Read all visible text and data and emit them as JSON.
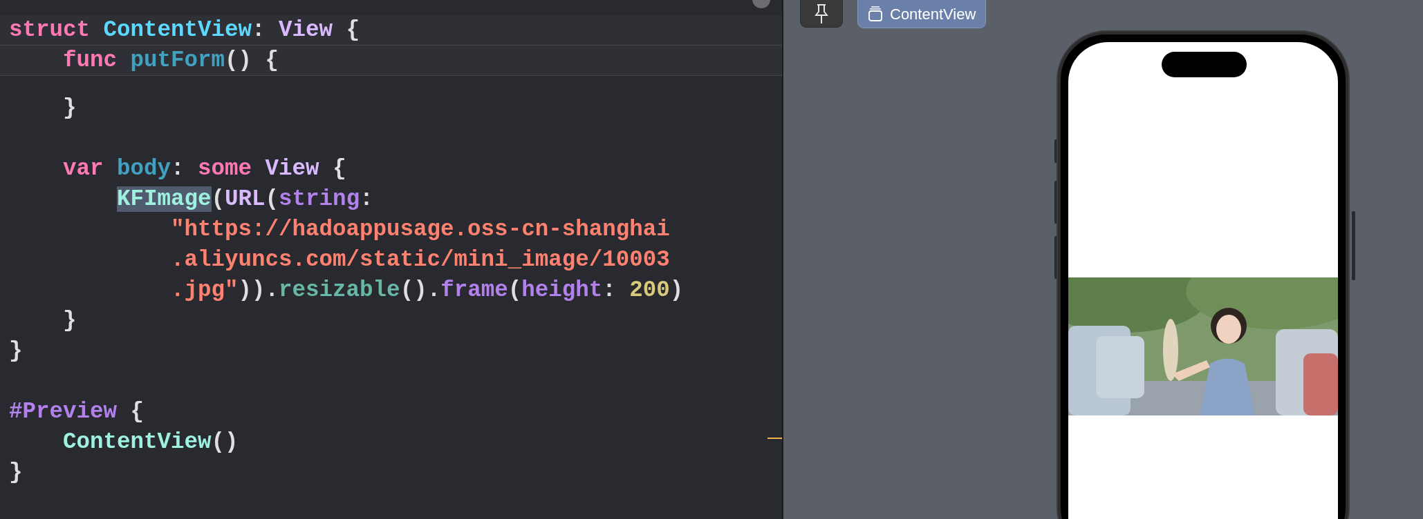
{
  "editor": {
    "sticky_header": [
      {
        "tokens": [
          {
            "text": "struct",
            "kind": "keyword"
          },
          {
            "text": " ContentView",
            "kind": "decl_type"
          },
          {
            "text": ": ",
            "kind": "plain"
          },
          {
            "text": "View",
            "kind": "type"
          },
          {
            "text": " {",
            "kind": "plain"
          }
        ]
      },
      {
        "tokens": [
          {
            "text": "    func",
            "kind": "keyword"
          },
          {
            "text": " putForm",
            "kind": "decl"
          },
          {
            "text": "() {",
            "kind": "plain"
          }
        ]
      }
    ],
    "blocks": [
      {
        "lines": [
          {
            "tokens": [
              {
                "text": "    }",
                "kind": "plain"
              }
            ]
          }
        ]
      },
      {
        "lines": [
          {
            "tokens": [
              {
                "text": "    var",
                "kind": "keyword"
              },
              {
                "text": " body",
                "kind": "decl"
              },
              {
                "text": ": ",
                "kind": "plain"
              },
              {
                "text": "some",
                "kind": "keyword"
              },
              {
                "text": " View",
                "kind": "type"
              },
              {
                "text": " {",
                "kind": "plain"
              }
            ]
          },
          {
            "tokens": [
              {
                "text": "        KFImage",
                "kind": "project",
                "highlighted": true
              },
              {
                "text": "(",
                "kind": "plain"
              },
              {
                "text": "URL",
                "kind": "type"
              },
              {
                "text": "(",
                "kind": "plain"
              },
              {
                "text": "string",
                "kind": "member"
              },
              {
                "text": ":",
                "kind": "plain"
              }
            ]
          },
          {
            "tokens": [
              {
                "text": "            \"https://hadoappusage.oss-cn-shanghai",
                "kind": "string"
              }
            ]
          },
          {
            "tokens": [
              {
                "text": "            .aliyuncs.com/static/mini_image/10003",
                "kind": "string"
              }
            ]
          },
          {
            "tokens": [
              {
                "text": "            .jpg\"",
                "kind": "string"
              },
              {
                "text": ")).",
                "kind": "plain"
              },
              {
                "text": "resizable",
                "kind": "method"
              },
              {
                "text": "().",
                "kind": "plain"
              },
              {
                "text": "frame",
                "kind": "member"
              },
              {
                "text": "(",
                "kind": "plain"
              },
              {
                "text": "height",
                "kind": "member"
              },
              {
                "text": ": ",
                "kind": "plain"
              },
              {
                "text": "200",
                "kind": "number"
              },
              {
                "text": ")",
                "kind": "plain"
              }
            ]
          },
          {
            "tokens": [
              {
                "text": "    }",
                "kind": "plain"
              }
            ]
          },
          {
            "tokens": [
              {
                "text": "}",
                "kind": "plain"
              }
            ]
          }
        ]
      },
      {
        "lines": [
          {
            "tokens": [
              {
                "text": "#Preview",
                "kind": "macro"
              },
              {
                "text": " {",
                "kind": "plain"
              }
            ]
          },
          {
            "tokens": [
              {
                "text": "    ContentView",
                "kind": "project"
              },
              {
                "text": "()",
                "kind": "plain"
              }
            ]
          },
          {
            "tokens": [
              {
                "text": "}",
                "kind": "plain"
              }
            ]
          }
        ]
      }
    ]
  },
  "preview": {
    "pinned": false,
    "tab": {
      "label": "ContentView",
      "selected": true
    }
  }
}
